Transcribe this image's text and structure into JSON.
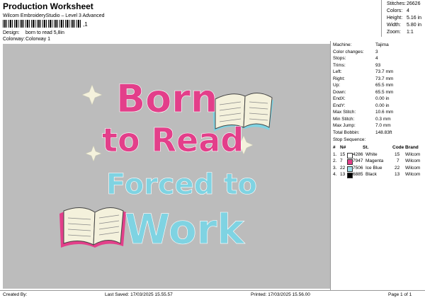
{
  "header": {
    "title": "Production Worksheet",
    "subtitle": "Wilcom EmbroideryStudio – Level 3 Advanced",
    "barcode_mark": ",1",
    "design_label": "Design:",
    "design_value": "born to read 5,8in",
    "colorway_label": "Colorway:",
    "colorway_value": "Colorway 1"
  },
  "summary": [
    {
      "k": "Stitches:",
      "v": "26626"
    },
    {
      "k": "Colors:",
      "v": "4"
    },
    {
      "k": "Height:",
      "v": "5.16 in"
    },
    {
      "k": "Width:",
      "v": "5.80 in"
    },
    {
      "k": "Zoom:",
      "v": "1:1"
    }
  ],
  "artwork": {
    "line1": "Born",
    "line2": "to Read",
    "line3": "Forced to",
    "line4": "Work",
    "colors": {
      "magenta": "#e33f8a",
      "iceblue": "#7fd3e2",
      "cream": "#f4f1dc",
      "bg": "#bcbcbc"
    }
  },
  "machine": [
    {
      "k": "Machine:",
      "v": "Tajima"
    },
    {
      "k": "Color changes:",
      "v": "3"
    },
    {
      "k": "Stops:",
      "v": "4"
    },
    {
      "k": "Trims:",
      "v": "93"
    },
    {
      "k": "Left:",
      "v": "73.7 mm"
    },
    {
      "k": "Right:",
      "v": "73.7 mm"
    },
    {
      "k": "Up:",
      "v": "65.5 mm"
    },
    {
      "k": "Down:",
      "v": "65.5 mm"
    },
    {
      "k": "EndX:",
      "v": "0.00 in"
    },
    {
      "k": "EndY:",
      "v": "0.00 in"
    },
    {
      "k": "Max Stitch:",
      "v": "10.6 mm"
    },
    {
      "k": "Min Stitch:",
      "v": "0.3 mm"
    },
    {
      "k": "Max Jump:",
      "v": "7.0 mm"
    },
    {
      "k": "Total Bobbin:",
      "v": "148.83ft"
    }
  ],
  "stop_sequence": {
    "title": "Stop Sequence:",
    "headers": [
      "#",
      "N#",
      "St.",
      "Code",
      "Brand"
    ],
    "rows": [
      {
        "num": "1.",
        "n": "15",
        "code_no": "4286",
        "name": "White",
        "st": "15",
        "brand": "Wilcom",
        "color": "#ffffff"
      },
      {
        "num": "2.",
        "n": "7",
        "code_no": "7947",
        "name": "Magenta",
        "st": "7",
        "brand": "Wilcom",
        "color": "#e33f8a"
      },
      {
        "num": "3.",
        "n": "22",
        "code_no": "7506",
        "name": "Ice Blue",
        "st": "22",
        "brand": "Wilcom",
        "color": "#9fdbe8"
      },
      {
        "num": "4.",
        "n": "13",
        "code_no": "6885",
        "name": "Black",
        "st": "13",
        "brand": "Wilcom",
        "color": "#000000"
      }
    ]
  },
  "footer": {
    "created": "Created By:",
    "saved": "Last Saved: 17/03/2025 15.55.57",
    "printed": "Printed: 17/03/2025 15.56.00",
    "page": "Page 1 of 1"
  }
}
